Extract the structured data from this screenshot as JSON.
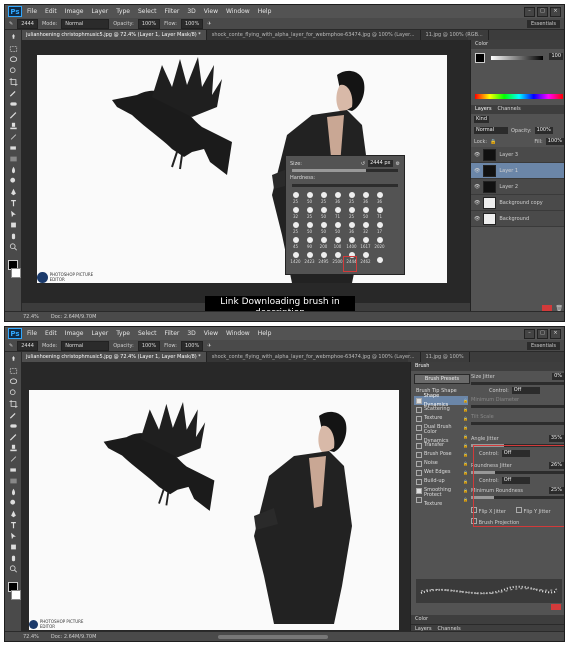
{
  "menu": {
    "app_logo": "Ps",
    "items": [
      "File",
      "Edit",
      "Image",
      "Layer",
      "Type",
      "Select",
      "Filter",
      "3D",
      "View",
      "Window",
      "Help"
    ]
  },
  "options": {
    "size_value": "2444",
    "mode_label": "Mode:",
    "mode_value": "Normal",
    "opacity_label": "Opacity:",
    "opacity_value": "100%",
    "flow_label": "Flow:",
    "flow_value": "100%",
    "workspace": "Essentials"
  },
  "tabs_top": [
    "julianhoening christophmusic5.jpg @ 72.4% (Layer 1, Layer Mask/8) *",
    "shock_conte_flying_with_alpha_layer_for_webmphoe-63474.jpg @ 100% (Layer...",
    "11.jpg @ 100% (RGB..."
  ],
  "tabs_bottom": [
    "julianhoening christophmusic5.jpg @ 72.4% (Layer 1, Layer Mask/8) *",
    "shock_conte_flying_with_alpha_layer_for_webmphoe-63474.jpg @ 100% (Layer...",
    "11.jpg @ 100%"
  ],
  "status": {
    "zoom": "72.4%",
    "doc": "Doc: 2.64M/9.70M"
  },
  "subtitle": {
    "line1": "Link Downloading brush in",
    "line2": "description"
  },
  "watermark": "PHOTOSHOP PICTURE EDITOR",
  "brush_picker": {
    "size_label": "Size:",
    "size_value": "2444 px",
    "hardness_label": "Hardness:",
    "brushes": [
      "25",
      "50",
      "25",
      "36",
      "25",
      "36",
      "36",
      "32",
      "25",
      "50",
      "71",
      "25",
      "50",
      "71",
      "25",
      "50",
      "50",
      "50",
      "36",
      "32",
      "17",
      "45",
      "90",
      "200",
      "100",
      "1400",
      "1617",
      "2020",
      "1420",
      "2423",
      "2495",
      "2500",
      "2444",
      "2462",
      ""
    ]
  },
  "layers": {
    "tabs": [
      "Layers",
      "Channels"
    ],
    "kind_label": "Kind",
    "blend": "Normal",
    "opacity_label": "Opacity:",
    "opacity_value": "100%",
    "lock_label": "Lock:",
    "fill_label": "Fill:",
    "fill_value": "100%",
    "items": [
      {
        "name": "Layer 3",
        "selected": false
      },
      {
        "name": "Layer 1",
        "selected": true
      },
      {
        "name": "Layer 2",
        "selected": false
      },
      {
        "name": "Background copy",
        "selected": false
      },
      {
        "name": "Background",
        "selected": false
      }
    ]
  },
  "color_panel": {
    "title": "Color",
    "value": "100"
  },
  "brush_panel": {
    "tabs": [
      "Brush"
    ],
    "presets_button": "Brush Presets",
    "size_jitter_label": "Size Jitter",
    "size_jitter_value": "0%",
    "control_label": "Control:",
    "control_value": "Off",
    "min_diameter_label": "Minimum Diameter",
    "tilt_scale_label": "Tilt Scale",
    "angle_jitter_label": "Angle Jitter",
    "angle_jitter_value": "35%",
    "roundness_jitter_label": "Roundness Jitter",
    "roundness_jitter_value": "26%",
    "min_roundness_label": "Minimum Roundness",
    "min_roundness_value": "25%",
    "flip_x": "Flip X Jitter",
    "flip_y": "Flip Y Jitter",
    "brush_projection": "Brush Projection",
    "list": [
      {
        "name": "Brush Tip Shape",
        "checked": null,
        "selected": false
      },
      {
        "name": "Shape Dynamics",
        "checked": true,
        "selected": true
      },
      {
        "name": "Scattering",
        "checked": false,
        "selected": false
      },
      {
        "name": "Texture",
        "checked": false,
        "selected": false
      },
      {
        "name": "Dual Brush",
        "checked": false,
        "selected": false
      },
      {
        "name": "Color Dynamics",
        "checked": false,
        "selected": false
      },
      {
        "name": "Transfer",
        "checked": false,
        "selected": false
      },
      {
        "name": "Brush Pose",
        "checked": false,
        "selected": false
      },
      {
        "name": "Noise",
        "checked": false,
        "selected": false
      },
      {
        "name": "Wet Edges",
        "checked": false,
        "selected": false
      },
      {
        "name": "Build-up",
        "checked": false,
        "selected": false
      },
      {
        "name": "Smoothing",
        "checked": true,
        "selected": false
      },
      {
        "name": "Protect Texture",
        "checked": false,
        "selected": false
      }
    ]
  },
  "bottom_panel_tabs": [
    "Color",
    "Layers",
    "Channels"
  ]
}
